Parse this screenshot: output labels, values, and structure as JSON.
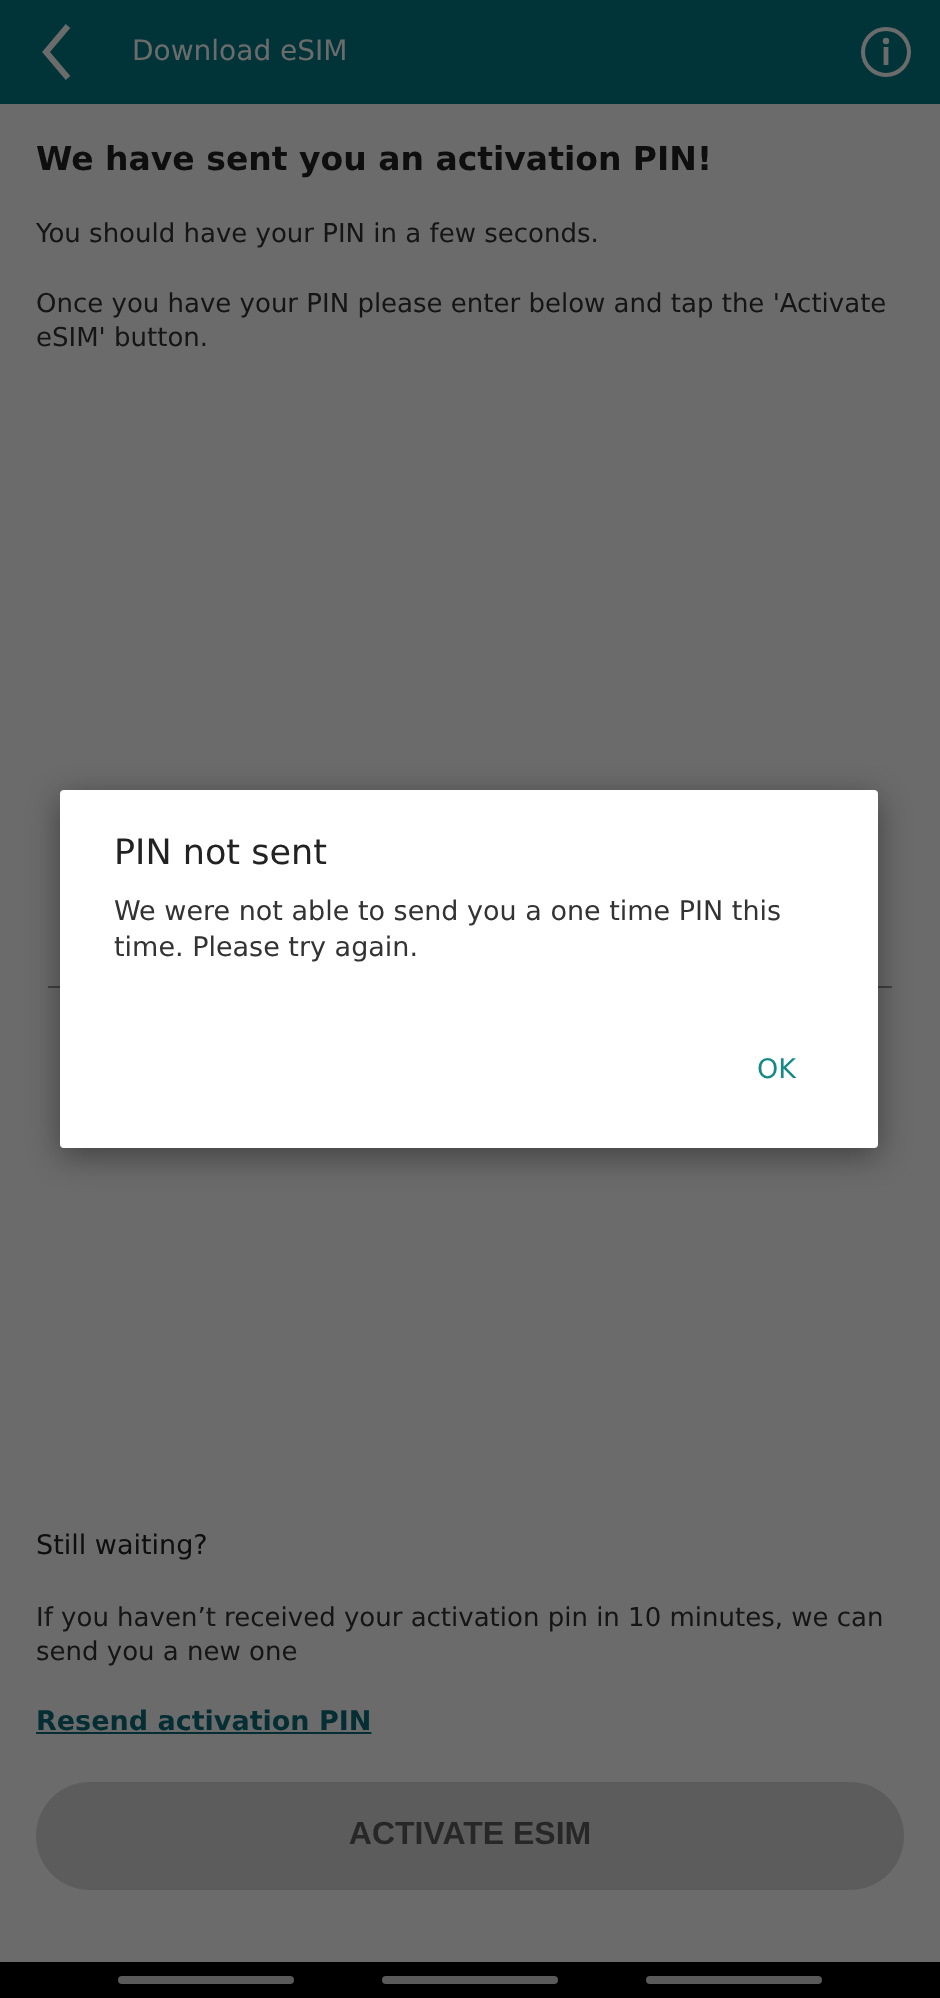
{
  "header": {
    "title": "Download eSIM"
  },
  "heading": "We have sent you an activation PIN!",
  "paragraphs": [
    "You should have your PIN in a few seconds.",
    "Once you have your PIN please enter below and tap the 'Activate eSIM' button."
  ],
  "waiting": {
    "title": "Still waiting?",
    "text": "If you haven’t received your activation pin in 10 minutes, we can send you a new one",
    "link": "Resend activation PIN"
  },
  "activate_button": {
    "label": "ACTIVATE ESIM",
    "disabled": true
  },
  "dialog": {
    "title": "PIN not sent",
    "message": "We were not able to send you a one time PIN this time. Please try again.",
    "buttons": [
      "OK"
    ]
  }
}
